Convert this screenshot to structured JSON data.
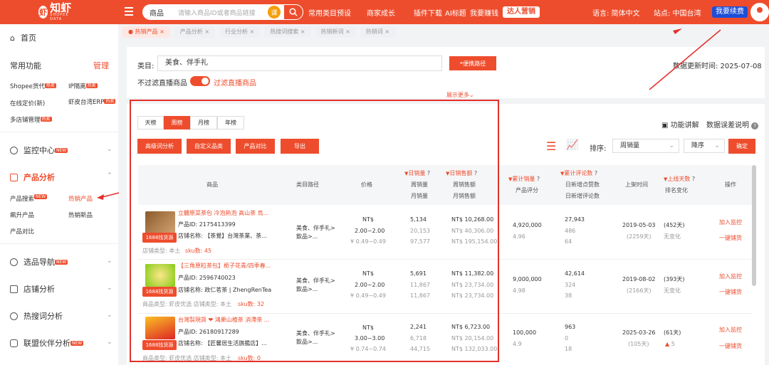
{
  "header": {
    "logo_text": "知虾",
    "logo_sub": "SHOPEE DATA",
    "search_category": "商品",
    "search_placeholder": "请输入商品ID或者商品链接",
    "search_badge": "课",
    "nav": [
      "常用类目预设",
      "商家成长",
      "插件下载",
      "AI标题",
      "我要赚钱"
    ],
    "vip_button": "达人营销",
    "language": "语言: 简体中文",
    "site": "站点: 中国台湾",
    "renew": "我要续费"
  },
  "sidebar": {
    "home": "首页",
    "common": "常用功能",
    "manage": "管理",
    "links": [
      "Shopee货代",
      "IP隔离",
      "在线定价(新)",
      "虾皮台湾ERP",
      "多店铺管理"
    ],
    "monitor": "监控中心",
    "product": "产品分析",
    "product_sub": [
      "产品搜索",
      "热销产品",
      "飙升产品",
      "热销新品",
      "产品对比"
    ],
    "selection": "选品导航",
    "shop": "店铺分析",
    "keyword": "热搜词分析",
    "alliance": "联盟伙伴分析",
    "new_badge": "NEW",
    "hot_badge": "热卖"
  },
  "tabs": [
    "热销产品",
    "产品分析",
    "行业分析",
    "热搜词搜索",
    "热销新词",
    "热销词"
  ],
  "filter": {
    "category_label": "类目:",
    "category_value": "美食、伴手礼",
    "path_button": "便携路径",
    "filter_live_off": "不过滤直播商品",
    "filter_live_on": "过滤直播商品",
    "expand": "展示更多",
    "update_time": "数据更新时间: 2025-07-08"
  },
  "toolbar": {
    "periods": [
      "天榜",
      "周榜",
      "月榜",
      "年榜"
    ],
    "buttons": [
      "高级词分析",
      "自定义品类",
      "产品对比",
      "导出"
    ],
    "feature": "功能讲解",
    "data_note": "数据误差说明",
    "sort_label": "排序:",
    "sort_value": "周销量",
    "order": "降序",
    "confirm": "确定"
  },
  "table": {
    "headers": {
      "product": "商品",
      "path": "类目路径",
      "price": "价格",
      "daily_sales": "日销量",
      "week_sales": "周销量",
      "month_sales": "月销量",
      "daily_rev": "日销售额",
      "week_rev": "周销售额",
      "month_rev": "月销售额",
      "total_sales": "累计销量",
      "rating": "产品评分",
      "reviews": "累计评论数",
      "daily_reviews": "日新增点赞数",
      "new_reviews": "日新增评论数",
      "listed": "上架时间",
      "days": "上线天数",
      "rank": "排名变化",
      "action": "操作"
    },
    "rows": [
      {
        "title": "立體原菜茶包 冷泡熱泡 高山茶 烏...",
        "pid": "产品ID: 2175413399",
        "shop": "店铺名称: 【茶覺】台灣茶業、茶...",
        "type": "店铺类型: 本土",
        "sku": "sku数: 45",
        "path": "美食、伴手礼>飲品>...",
        "price_cur": "NT$",
        "price": "2.00~2.00",
        "price2": "0.49~0.49",
        "ds": "5,134",
        "ws": "20,153",
        "ms": "97,577",
        "dr": "NT$ 10,268.00",
        "wr": "NT$ 40,306.00",
        "mr": "NT$ 195,154.00",
        "total": "4,920,000",
        "rating": "4.96",
        "rev": "27,943",
        "rev_a": "486",
        "rev_b": "64",
        "listed": "2019-05-03",
        "days_sub": "(2259天)",
        "days": "(452天)",
        "rank": "无变化"
      },
      {
        "title": "【三角原粒茶包】栀子花青/四季春...",
        "pid": "产品ID: 2596740023",
        "shop": "店铺名称: 政仁茗茶 | ZhengRenTea",
        "type": "商品类型: 虾皮优选   店铺类型: 本土",
        "sku": "sku数: 32",
        "path": "美食、伴手礼>飲品>...",
        "price_cur": "NT$",
        "price": "2.00~2.00",
        "price2": "0.49~0.49",
        "ds": "5,691",
        "ws": "11,867",
        "ms": "11,867",
        "dr": "NT$ 11,382.00",
        "wr": "NT$ 23,734.00",
        "mr": "NT$ 23,734.00",
        "total": "9,000,000",
        "rating": "4.98",
        "rev": "42,614",
        "rev_a": "324",
        "rev_b": "38",
        "listed": "2019-08-02",
        "days_sub": "(2166天)",
        "days": "(393天)",
        "rank": "无变化"
      },
      {
        "title": "台灣製現貨 ❤ 鴻果山楂茶 消滯茶 ...",
        "pid": "产品ID: 26180917289",
        "shop": "店铺名称: 【匠馨居生活旗艦店】...",
        "type": "商品类型: 虾皮优选   店铺类型: 本土",
        "sku": "sku数: 0",
        "path": "美食、伴手礼>飲品>...",
        "price_cur": "NT$",
        "price": "3.00~3.00",
        "price2": "0.74~0.74",
        "ds": "2,241",
        "ws": "6,718",
        "ms": "44,715",
        "dr": "NT$ 6,723.00",
        "wr": "NT$ 20,154.00",
        "mr": "NT$ 132,033.00",
        "total": "100,000",
        "rating": "4.9",
        "rev": "963",
        "rev_a": "0",
        "rev_b": "18",
        "listed": "2025-03-26",
        "days_sub": "(105天)",
        "days": "(61天)",
        "rank": "5"
      }
    ],
    "actions": [
      "加入监控",
      "一键铺货"
    ],
    "source_badge": "1688找货源"
  }
}
